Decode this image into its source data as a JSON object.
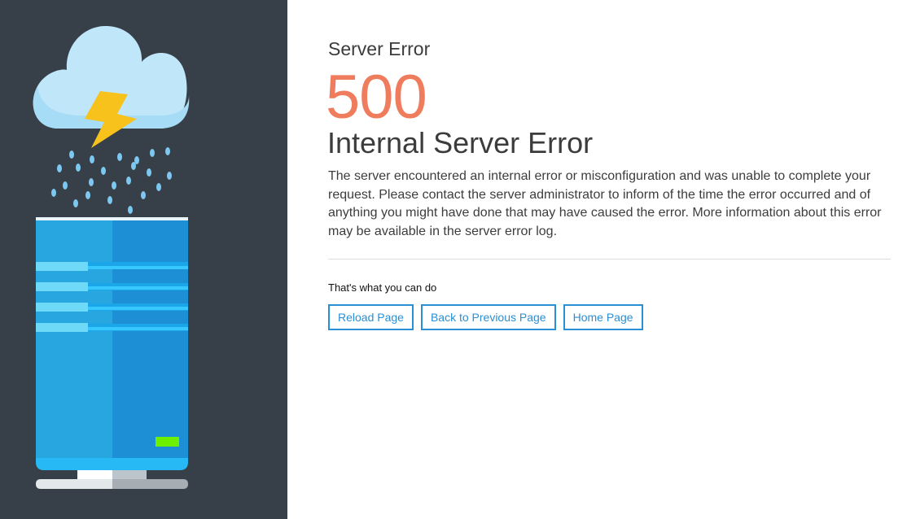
{
  "error": {
    "eyebrow": "Server Error",
    "code": "500",
    "headline": "Internal Server Error",
    "description": "The server encountered an internal error or misconfiguration and was unable to complete your request. Please contact the server administrator to inform of the time the error occurred and of anything you might have done that may have caused the error. More information about this error may be available in the server error log."
  },
  "actions": {
    "label": "That's what you can do",
    "reload": "Reload Page",
    "back": "Back to Previous Page",
    "home": "Home Page"
  },
  "illustration": {
    "icons": [
      "cloud-icon",
      "lightning-icon",
      "raindrop-icon",
      "server-icon"
    ],
    "colors": {
      "panel": "#374049",
      "accent_code": "#ef7c5c",
      "button": "#2a8fd3",
      "cloud": "#bfe6f9",
      "bolt": "#f7c21b",
      "server": "#1d8fd5",
      "led": "#6df000"
    }
  }
}
